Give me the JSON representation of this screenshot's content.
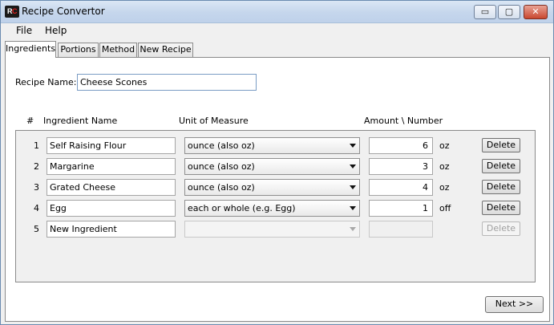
{
  "window": {
    "title": "Recipe Convertor",
    "icon_text_a": "R",
    "icon_text_b": "C",
    "controls": {
      "minimize": "▭",
      "maximize": "▢",
      "close": "✕"
    }
  },
  "menu": {
    "file": "File",
    "help": "Help"
  },
  "tabs": [
    {
      "label": "Ingredients",
      "active": true
    },
    {
      "label": "Portions",
      "active": false
    },
    {
      "label": "Method",
      "active": false
    },
    {
      "label": "New Recipe",
      "active": false
    }
  ],
  "recipe": {
    "label": "Recipe Name:",
    "value": "Cheese Scones"
  },
  "columns": {
    "num": "#",
    "name": "Ingredient Name",
    "unit": "Unit of Measure",
    "amount": "Amount \\ Number"
  },
  "ingredients": [
    {
      "num": "1",
      "name": "Self Raising Flour",
      "unit": "ounce (also oz)",
      "amount": "6",
      "abbr": "oz",
      "delete": "Delete",
      "enabled": true
    },
    {
      "num": "2",
      "name": "Margarine",
      "unit": "ounce (also oz)",
      "amount": "3",
      "abbr": "oz",
      "delete": "Delete",
      "enabled": true
    },
    {
      "num": "3",
      "name": "Grated Cheese",
      "unit": "ounce (also oz)",
      "amount": "4",
      "abbr": "oz",
      "delete": "Delete",
      "enabled": true
    },
    {
      "num": "4",
      "name": "Egg",
      "unit": "each or whole (e.g. Egg)",
      "amount": "1",
      "abbr": "off",
      "delete": "Delete",
      "enabled": true
    },
    {
      "num": "5",
      "name": "New Ingredient",
      "unit": "",
      "amount": "",
      "abbr": "",
      "delete": "Delete",
      "enabled": false
    }
  ],
  "footer": {
    "next": "Next >>"
  }
}
